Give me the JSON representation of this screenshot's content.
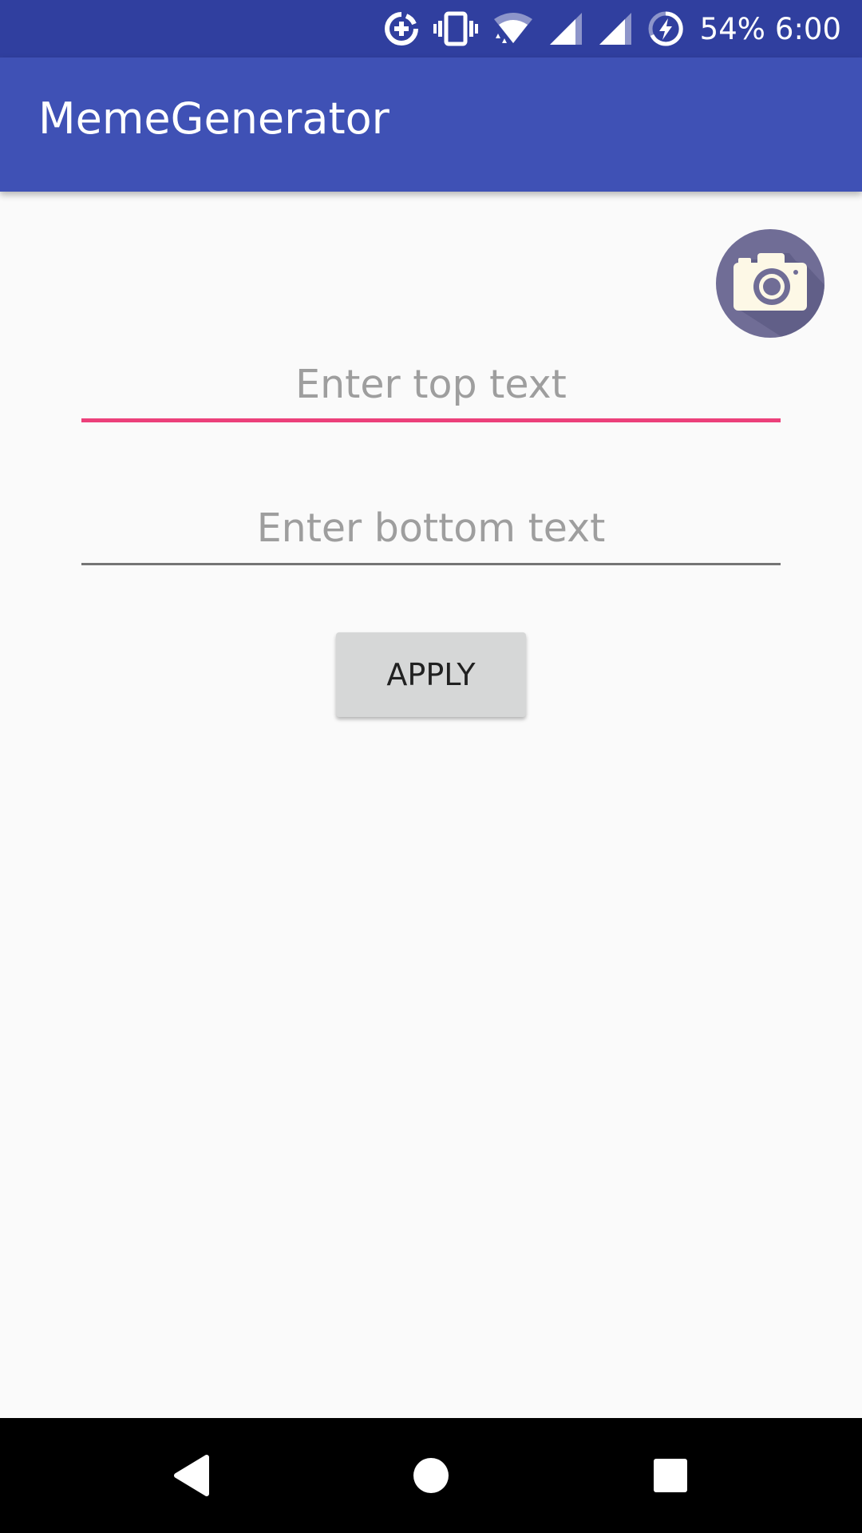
{
  "status_bar": {
    "battery_percent": "54%",
    "time": "6:00",
    "icons": [
      "data-saver-icon",
      "vibrate-icon",
      "wifi-icon",
      "signal-icon",
      "signal-icon-2",
      "battery-charging-icon"
    ]
  },
  "app_bar": {
    "title": "MemeGenerator",
    "color": "#3f51b5",
    "status_color": "#303f9f"
  },
  "camera": {
    "icon": "camera-icon"
  },
  "form": {
    "top_text": {
      "value": "",
      "placeholder": "Enter top text",
      "accent": "#ec407a"
    },
    "bottom_text": {
      "value": "",
      "placeholder": "Enter bottom text"
    },
    "apply_label": "APPLY"
  },
  "nav_bar": {
    "icons": [
      "back-icon",
      "home-icon",
      "recents-icon"
    ]
  }
}
